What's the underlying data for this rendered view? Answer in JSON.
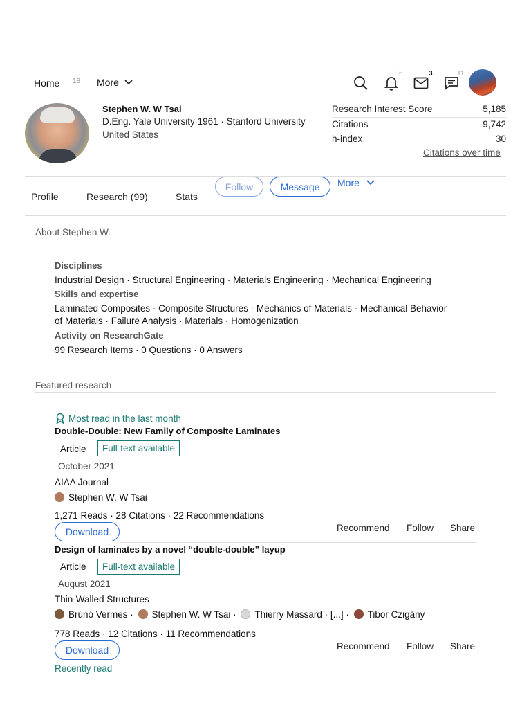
{
  "nav": {
    "home": "Home",
    "home_badge": "18",
    "more": "More",
    "notif_badge": "6",
    "mail_badge": "3",
    "chat_badge": "11"
  },
  "profile": {
    "name": "Stephen W. W Tsai",
    "degree": "D.Eng. Yale University 1961 · Stanford University",
    "location": "United States"
  },
  "stats": {
    "items": [
      {
        "label": "Research Interest Score",
        "value": "5,185"
      },
      {
        "label": "Citations",
        "value": "9,742"
      },
      {
        "label": "h-index",
        "value": "30"
      }
    ],
    "link": "Citations over time"
  },
  "tabs": {
    "profile": "Profile",
    "research": "Research (99)",
    "stats": "Stats",
    "follow": "Follow",
    "message": "Message",
    "more": "More"
  },
  "about": {
    "title": "About Stephen W.",
    "disciplines_head": "Disciplines",
    "disciplines": "Industrial Design · Structural Engineering · Materials Engineering · Mechanical Engineering",
    "skills_head": "Skills and expertise",
    "skills_1": "Laminated Composites · Composite Structures · Mechanics of Materials · Mechanical Behavior",
    "skills_2": "of Materials · Failure Analysis · Materials · Homogenization",
    "activity_head": "Activity on ResearchGate",
    "activity": "99 Research Items · 0 Questions · 0 Answers"
  },
  "featured": {
    "title": "Featured research",
    "most_read": "Most read in the last month",
    "recently_read": "Recently read",
    "papers": [
      {
        "title": "Double-Double: New Family of Composite Laminates",
        "type": "Article",
        "badge": "Full-text available",
        "date": "October 2021",
        "journal": "AIAA Journal",
        "authors": [
          "Stephen W. W Tsai"
        ],
        "metrics": "1,271 Reads · 28 Citations · 22 Recommendations",
        "download": "Download",
        "recommend": "Recommend",
        "follow": "Follow",
        "share": "Share"
      },
      {
        "title": "Design of laminates by a novel “double-double” layup",
        "type": "Article",
        "badge": "Full-text available",
        "date": "August 2021",
        "journal": "Thin-Walled Structures",
        "authors": [
          "Brúnó Vermes",
          "Stephen W. W Tsai",
          "Thierry Massard",
          "[...]",
          "Tibor Czigány"
        ],
        "metrics": "778 Reads · 12 Citations · 11 Recommendations",
        "download": "Download",
        "recommend": "Recommend",
        "follow": "Follow",
        "share": "Share"
      }
    ]
  },
  "colors": {
    "accent_blue": "#2a6bd1",
    "teal": "#1a7a72"
  }
}
